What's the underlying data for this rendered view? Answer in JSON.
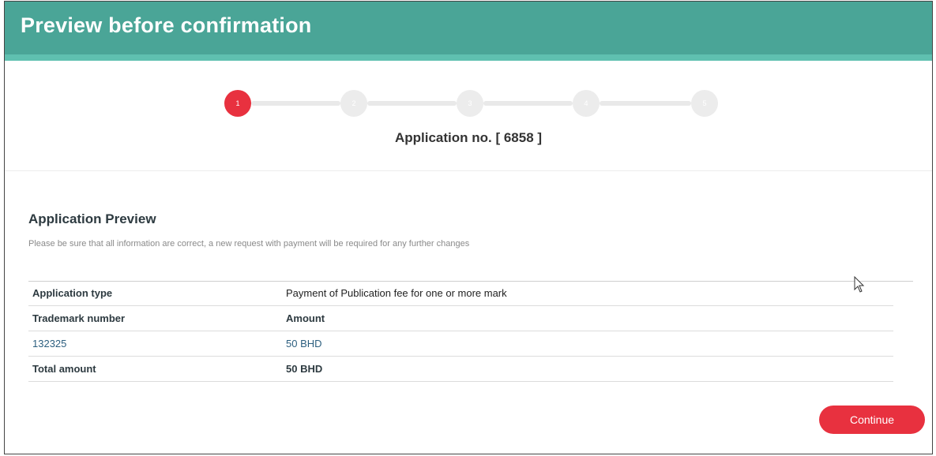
{
  "header": {
    "title": "Preview before confirmation"
  },
  "stepper": {
    "steps": [
      "1",
      "2",
      "3",
      "4",
      "5"
    ],
    "active_step": 1
  },
  "application_number_text": "Application no. [ 6858 ]",
  "preview": {
    "title": "Application Preview",
    "note": "Please be sure that all information are correct, a new request with payment will be required for any further changes",
    "rows": [
      {
        "label": "Application type",
        "value": "Payment of Publication fee for one or more mark"
      },
      {
        "label": "Trademark number",
        "value": "Amount"
      },
      {
        "label": "132325",
        "value": "50 BHD"
      },
      {
        "label": "Total amount",
        "value": "50 BHD"
      }
    ]
  },
  "actions": {
    "continue_label": "Continue"
  },
  "colors": {
    "header": "#4aa597",
    "accent": "#e8313f"
  }
}
